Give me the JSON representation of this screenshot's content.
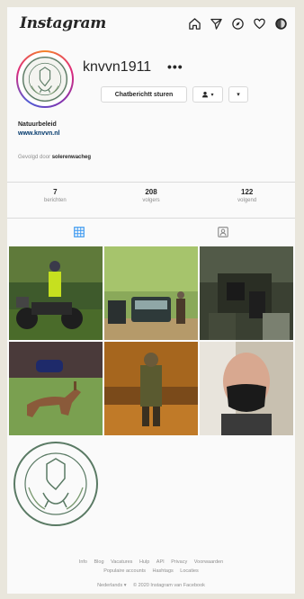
{
  "header": {
    "logo": "Instagram",
    "icons": [
      "home-icon",
      "direct-icon",
      "explore-icon",
      "heart-icon",
      "profile-icon"
    ]
  },
  "profile": {
    "username": "knvvn1911",
    "more": "•••",
    "message_button": "Chatberichtt sturen",
    "follow_button": "▾",
    "more_button": "▾",
    "bio_name": "Natuurbeleid",
    "bio_link": "www.knvvn.nl",
    "followed_by_prefix": "Gevolgd door",
    "followed_by_user": "solerenwacheg"
  },
  "stats": [
    {
      "num": "7",
      "label": "berichten"
    },
    {
      "num": "208",
      "label": "volgers"
    },
    {
      "num": "122",
      "label": "volgend"
    }
  ],
  "tabs": [
    "grid-icon",
    "tagged-icon"
  ],
  "footer": {
    "links_row1": [
      "Info",
      "Blog",
      "Vacatures",
      "Hulp",
      "API",
      "Privacy",
      "Voorwaarden"
    ],
    "links_row2": [
      "Populaire accounts",
      "Hashtags",
      "Locaties"
    ],
    "language": "Nederlands ▾",
    "copyright": "© 2020 Instagram van Facebook"
  },
  "colors": {
    "accent_link": "#00376b",
    "muted": "#8e8e8e"
  }
}
